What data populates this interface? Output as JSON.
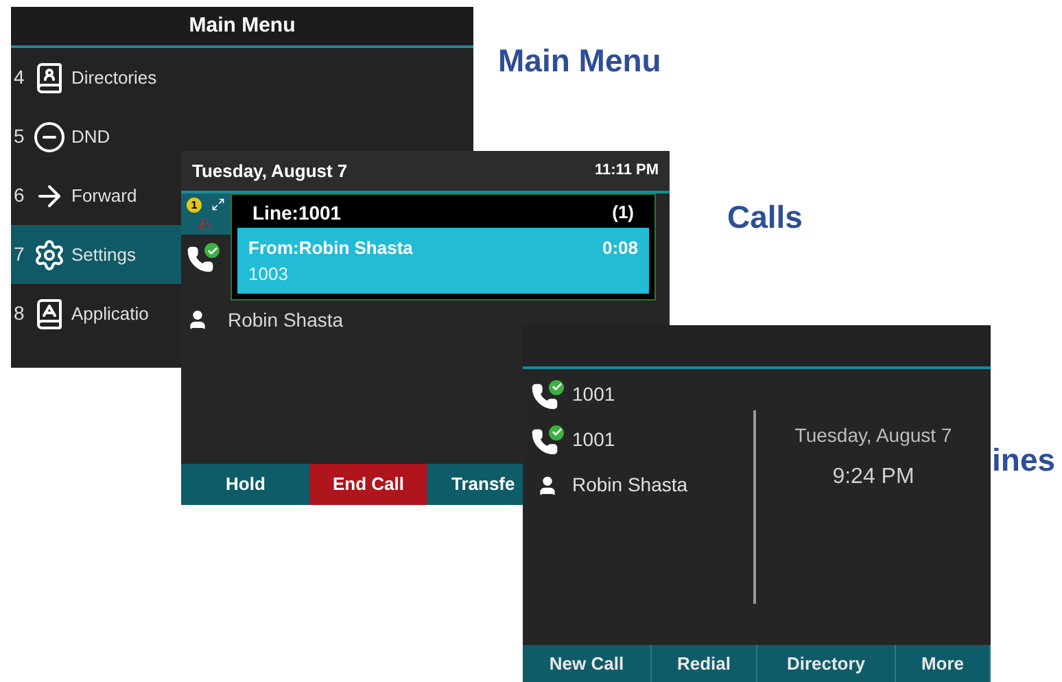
{
  "labels": [
    {
      "text": "Main Menu"
    },
    {
      "text": "Calls"
    },
    {
      "text": "ines"
    }
  ],
  "main_menu": {
    "title": "Main Menu",
    "items": [
      {
        "number": "4",
        "label": "Directories",
        "selected": false
      },
      {
        "number": "5",
        "label": "DND",
        "selected": false
      },
      {
        "number": "6",
        "label": "Forward",
        "selected": false
      },
      {
        "number": "7",
        "label": "Settings",
        "selected": true
      },
      {
        "number": "8",
        "label": "Applicatio",
        "selected": false
      }
    ]
  },
  "calls": {
    "date": "Tuesday, August 7",
    "time": "11:11 PM",
    "rows": [
      {
        "kind": "line",
        "badge": "1",
        "selected": true
      },
      {
        "kind": "phone",
        "selected": false
      },
      {
        "kind": "contact",
        "label": "Robin Shasta",
        "selected": false
      }
    ],
    "popup": {
      "line": "Line:1001",
      "count": "(1)",
      "caller": "From:Robin Shasta",
      "duration": "0:08",
      "number": "1003"
    },
    "softkeys": [
      {
        "label": "Hold",
        "kind": "normal"
      },
      {
        "label": "End Call",
        "kind": "end"
      },
      {
        "label": "Transfe",
        "kind": "normal"
      }
    ]
  },
  "lines": {
    "date": "Tuesday, August 7",
    "time": "9:24 PM",
    "rows": [
      {
        "kind": "phone",
        "label": "1001"
      },
      {
        "kind": "phone",
        "label": "1001"
      },
      {
        "kind": "contact",
        "label": "Robin Shasta"
      }
    ],
    "softkeys": [
      {
        "label": "New Call"
      },
      {
        "label": "Redial"
      },
      {
        "label": "Directory"
      },
      {
        "label": "More"
      }
    ]
  }
}
